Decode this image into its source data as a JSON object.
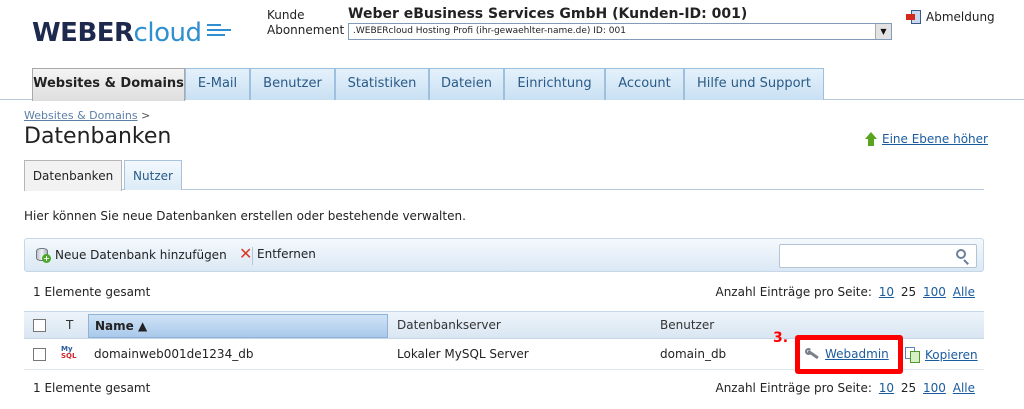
{
  "logo": {
    "weber": "WEBER",
    "cloud": "cloud"
  },
  "header": {
    "kunde_label": "Kunde",
    "abonnement_label": "Abonnement",
    "company": "Weber eBusiness Services GmbH (Kunden-ID: 001)",
    "subscription": ".WEBERcloud Hosting Profi (ihr-gewaehlter-name.de) ID: 001",
    "logout": "Abmeldung"
  },
  "nav": {
    "tabs": [
      {
        "label": "Websites & Domains"
      },
      {
        "label": "E-Mail"
      },
      {
        "label": "Benutzer"
      },
      {
        "label": "Statistiken"
      },
      {
        "label": "Dateien"
      },
      {
        "label": "Einrichtung"
      },
      {
        "label": "Account"
      },
      {
        "label": "Hilfe und Support"
      }
    ]
  },
  "breadcrumb": {
    "link": "Websites & Domains",
    "sep": ">"
  },
  "page_title": "Datenbanken",
  "up_link": "Eine Ebene höher",
  "subtabs": [
    {
      "label": "Datenbanken"
    },
    {
      "label": "Nutzer"
    }
  ],
  "description": "Hier können Sie neue Datenbanken erstellen oder bestehende verwalten.",
  "toolbar": {
    "add": "Neue Datenbank hinzufügen",
    "remove": "Entfernen",
    "search_value": ""
  },
  "pagination": {
    "total": "1 Elemente gesamt",
    "per_page_label": "Anzahl Einträge pro Seite:",
    "opt1": "10",
    "opt2": "25",
    "opt3": "100",
    "opt_all": "Alle"
  },
  "table": {
    "col_t": "T",
    "col_name": "Name ▲",
    "col_server": "Datenbankserver",
    "col_user": "Benutzer",
    "rows": [
      {
        "type_my": "My",
        "type_sql": "SQL",
        "name": "domainweb001de1234_db",
        "server": "Lokaler MySQL Server",
        "user": "domain_db",
        "webadmin": "Webadmin",
        "copy": "Kopieren"
      }
    ]
  },
  "annotation": {
    "step": "3."
  },
  "colors": {
    "accent": "#2f8fd0",
    "highlight": "#ff0000",
    "link": "#1a5b9e"
  }
}
